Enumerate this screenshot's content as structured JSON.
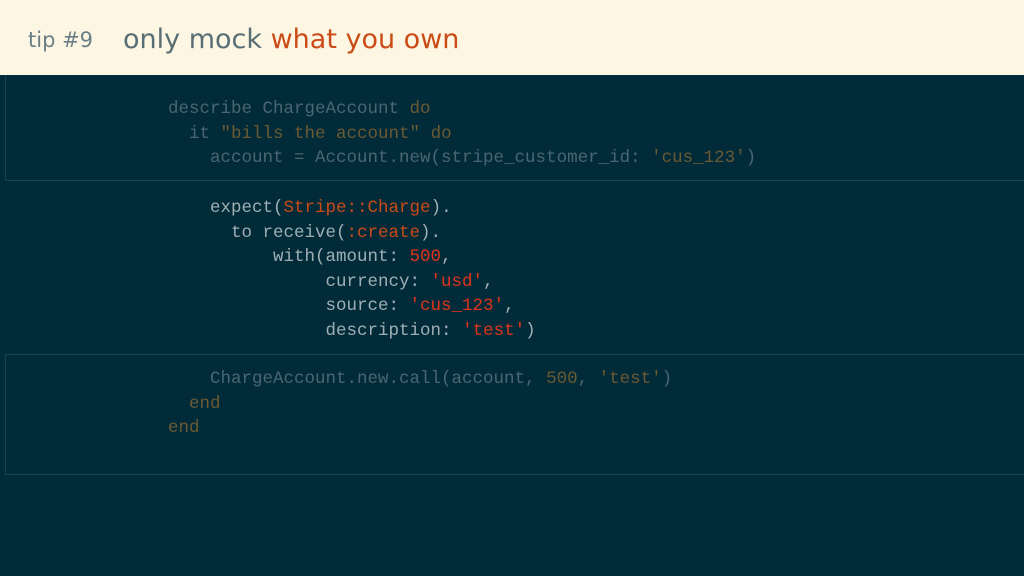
{
  "header": {
    "tip_label": "tip #9",
    "title_plain": "only mock ",
    "title_accent": "what you own"
  },
  "colors": {
    "background": "#022b3a",
    "header_bg": "#fdf6e3",
    "accent": "#cb4b16",
    "code_text": "#9fb0b5",
    "literal": "#e0341a"
  },
  "code_top": {
    "l1_a": "describe ChargeAccount ",
    "l1_kw": "do",
    "l2_a": "  it ",
    "l2_str": "\"bills the account\"",
    "l2_sp": " ",
    "l2_kw": "do",
    "l3_a": "    account = Account.new(stripe_customer_id: ",
    "l3_str": "'cus_123'",
    "l3_b": ")"
  },
  "code_mid": {
    "l1_a": "    expect(",
    "l1_const": "Stripe::Charge",
    "l1_b": ").",
    "l2_a": "      to receive(",
    "l2_sym": ":create",
    "l2_b": ").",
    "l3_a": "          with(amount: ",
    "l3_num": "500",
    "l3_b": ",",
    "l4_a": "               currency: ",
    "l4_str": "'usd'",
    "l4_b": ",",
    "l5_a": "               source: ",
    "l5_str": "'cus_123'",
    "l5_b": ",",
    "l6_a": "               description: ",
    "l6_str": "'test'",
    "l6_b": ")"
  },
  "code_bottom": {
    "l1_a": "    ChargeAccount.new.call(account, ",
    "l1_num": "500",
    "l1_b": ", ",
    "l1_str": "'test'",
    "l1_c": ")",
    "l2": "  end",
    "l3": "end"
  }
}
